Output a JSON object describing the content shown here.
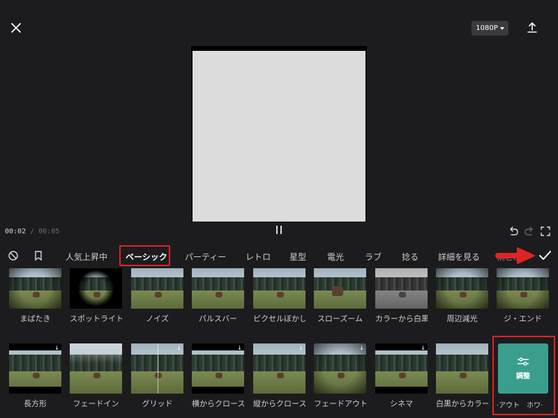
{
  "header": {
    "resolution": "1080P",
    "close_icon": "close-icon",
    "export_icon": "export-icon"
  },
  "player": {
    "current_time": "00:02",
    "separator": "/",
    "total_time": "00:05"
  },
  "categories": {
    "tabs": [
      "人気上昇中",
      "ベーシック",
      "パーティー",
      "レトロ",
      "星型",
      "電光",
      "ラブ",
      "捻る",
      "詳細を見る",
      "桐ど次"
    ],
    "active": "ベーシック"
  },
  "effects_row1": [
    "まばたき",
    "スポットライト",
    "ノイズ",
    "パルスバー",
    "ピクセルぼかし",
    "スローズーム",
    "カラーから白黒",
    "周辺減光",
    "ジ・エンド"
  ],
  "effects_row2": [
    "長方形",
    "フェードイン",
    "グリッド",
    "横からクロース",
    "縦からクロース",
    "フェードアウト",
    "シネマ",
    "白黒からカラー"
  ],
  "adjust": {
    "label": "調整",
    "partial_label": "·アウト　ホワ·"
  },
  "colors": {
    "background": "#1c1c1e",
    "annotation_red": "#e02424",
    "adjust_teal": "#3a9e8e"
  }
}
